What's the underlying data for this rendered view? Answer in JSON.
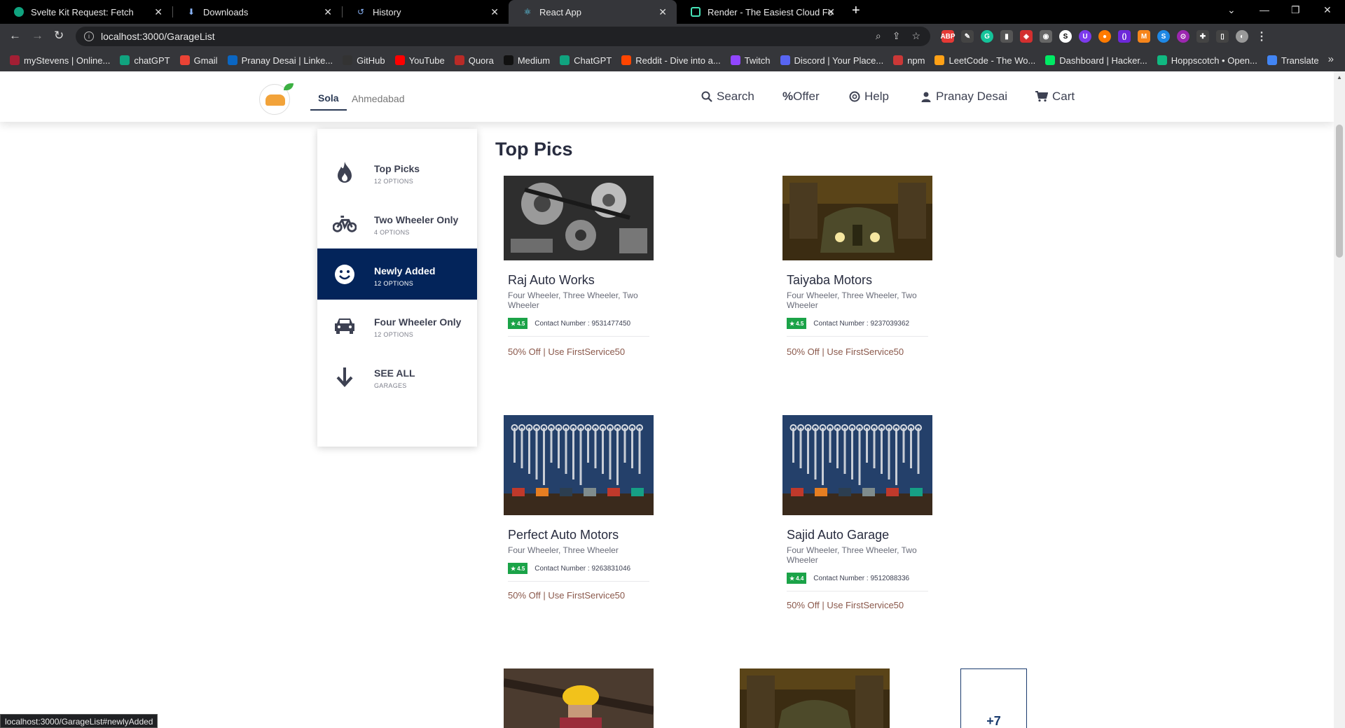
{
  "browser": {
    "tabs": [
      {
        "title": "Svelte Kit Request: Fetch",
        "icon": "chatgpt-icon",
        "color": "#10a37f"
      },
      {
        "title": "Downloads",
        "icon": "download-icon",
        "color": "#8ab4f8"
      },
      {
        "title": "History",
        "icon": "history-icon",
        "color": "#8ab4f8"
      },
      {
        "title": "React App",
        "icon": "react-icon",
        "color": "#61dafb"
      },
      {
        "title": "Render - The Easiest Cloud For Al",
        "icon": "render-icon",
        "color": "#46e3b7"
      }
    ],
    "active_tab": 3,
    "url": "localhost:3000/GarageList",
    "bookmarks": [
      {
        "label": "myStevens | Online...",
        "color": "#a31f34"
      },
      {
        "label": "chatGPT",
        "color": "#10a37f"
      },
      {
        "label": "Gmail",
        "color": "#ea4335"
      },
      {
        "label": "Pranay Desai | Linke...",
        "color": "#0a66c2"
      },
      {
        "label": "GitHub",
        "color": "#333333"
      },
      {
        "label": "YouTube",
        "color": "#ff0000"
      },
      {
        "label": "Quora",
        "color": "#b92b27"
      },
      {
        "label": "Medium",
        "color": "#111111"
      },
      {
        "label": "ChatGPT",
        "color": "#10a37f"
      },
      {
        "label": "Reddit - Dive into a...",
        "color": "#ff4500"
      },
      {
        "label": "Twitch",
        "color": "#9146ff"
      },
      {
        "label": "Discord | Your Place...",
        "color": "#5865f2"
      },
      {
        "label": "npm",
        "color": "#cb3837"
      },
      {
        "label": "LeetCode - The Wo...",
        "color": "#ffa116"
      },
      {
        "label": "Dashboard | Hacker...",
        "color": "#00ea64"
      },
      {
        "label": "Hoppscotch • Open...",
        "color": "#10b981"
      },
      {
        "label": "Translate",
        "color": "#4285f4"
      }
    ],
    "status_url": "localhost:3000/GarageList#newlyAdded"
  },
  "header": {
    "location_active": "Sola",
    "location_city": "Ahmedabad",
    "nav": {
      "search": "Search",
      "offer": "Offer",
      "help": "Help",
      "user": "Pranay Desai",
      "cart": "Cart"
    }
  },
  "sidebar": {
    "items": [
      {
        "label": "Top Picks",
        "sub": "12 OPTIONS",
        "icon": "flame-icon"
      },
      {
        "label": "Two Wheeler Only",
        "sub": "4 OPTIONS",
        "icon": "bicycle-icon"
      },
      {
        "label": "Newly Added",
        "sub": "12 OPTIONS",
        "icon": "smiley-icon"
      },
      {
        "label": "Four Wheeler Only",
        "sub": "12 OPTIONS",
        "icon": "car-icon"
      },
      {
        "label": "SEE ALL",
        "sub": "GARAGES",
        "icon": "arrow-down-icon"
      }
    ],
    "active_index": 2
  },
  "main": {
    "title": "Top Pics",
    "cards": [
      {
        "name": "Raj Auto Works",
        "cats": "Four Wheeler, Three Wheeler, Two Wheeler",
        "rating": "4.5",
        "contact_label": "Contact Number : ",
        "contact": "9531477450",
        "offer": "50% Off | Use FirstService50",
        "image": "engine-photo"
      },
      {
        "name": "Taiyaba Motors",
        "cats": "Four Wheeler, Three Wheeler, Two Wheeler",
        "rating": "4.5",
        "contact_label": "Contact Number : ",
        "contact": "9237039362",
        "offer": "50% Off | Use FirstService50",
        "image": "vintage-garage-photo"
      },
      {
        "name": "Perfect Auto Motors",
        "cats": "Four Wheeler, Three Wheeler",
        "rating": "4.5",
        "contact_label": "Contact Number : ",
        "contact": "9263831046",
        "offer": "50% Off | Use FirstService50",
        "image": "wrench-wall-photo"
      },
      {
        "name": "Sajid Auto Garage",
        "cats": "Four Wheeler, Three Wheeler, Two Wheeler",
        "rating": "4.4",
        "contact_label": "Contact Number : ",
        "contact": "9512088336",
        "offer": "50% Off | Use FirstService50",
        "image": "wrench-wall-photo"
      }
    ],
    "more_count": "+7"
  }
}
